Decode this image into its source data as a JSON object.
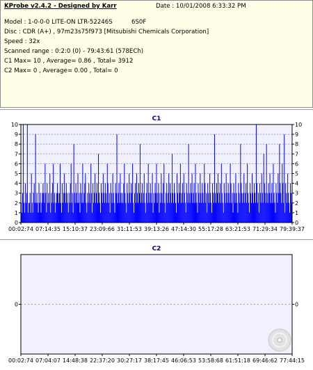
{
  "header": {
    "title": "KProbe v2.4.2 - Designed by Karr",
    "date": "Date : 10/01/2008 6:33:32 PM",
    "model": "Model : 1-0-0-0 LITE-ON LTR-52246S",
    "firmware": "6S0F",
    "disc": "Disc : CDR (A+) , 97m23s75f973 [Mitsubishi Chemicals Corporation]",
    "speed": "Speed : 32x",
    "scanned_range": "Scanned range : 0:2:0 (0) - 79:43:61 (578ECh)",
    "c1_stats": "C1 Max= 10 , Average= 0.86 , Total= 3912",
    "c2_stats": "C2 Max= 0 , Average= 0.00 , Total= 0"
  },
  "colors": {
    "info_background": "#ffffe7",
    "plot_background": "#f0f0ff",
    "c1_bars": "#0000ff",
    "title_blue": "#000080"
  },
  "chart_data": [
    {
      "type": "bar",
      "title": "C1",
      "ylim": [
        0,
        10
      ],
      "yticks": [
        "0",
        "1",
        "2",
        "3",
        "4",
        "5",
        "6",
        "7",
        "8",
        "9",
        "10"
      ],
      "xticks": [
        "00:02:74",
        "07:14:35",
        "15:10:37",
        "23:09:66",
        "31:11:53",
        "39:13:26",
        "47:14:30",
        "55:17:28",
        "63:21:53",
        "71:29:34",
        "79:39:37"
      ],
      "grid": true,
      "values": [
        2,
        1,
        3,
        10,
        2,
        1,
        4,
        2,
        3,
        10,
        1,
        2,
        2,
        3,
        1,
        5,
        2,
        1,
        3,
        4,
        2,
        9,
        2,
        3,
        2,
        1,
        4,
        2,
        3,
        1,
        2,
        3,
        4,
        3,
        2,
        6,
        3,
        1,
        4,
        2,
        3,
        2,
        5,
        1,
        3,
        2,
        4,
        6,
        2,
        3,
        1,
        2,
        3,
        4,
        3,
        2,
        3,
        6,
        2,
        1,
        4,
        2,
        3,
        5,
        3,
        2,
        4,
        3,
        2,
        1,
        3,
        2,
        4,
        6,
        2,
        3,
        1,
        8,
        3,
        2,
        4,
        3,
        2,
        5,
        2,
        3,
        1,
        4,
        3,
        2,
        6,
        2,
        3,
        4,
        5,
        2,
        1,
        3,
        2,
        4,
        3,
        2,
        6,
        3,
        1,
        4,
        2,
        3,
        5,
        2,
        3,
        4,
        2,
        7,
        3,
        2,
        1,
        4,
        3,
        2,
        5,
        3,
        2,
        4,
        3,
        2,
        6,
        4,
        2,
        3,
        1,
        4,
        3,
        2,
        5,
        3,
        2,
        1,
        4,
        3,
        9,
        2,
        3,
        4,
        2,
        5,
        3,
        2,
        3,
        2,
        4,
        6,
        3,
        2,
        1,
        4,
        3,
        2,
        5,
        3,
        2,
        4,
        3,
        6,
        2,
        1,
        3,
        4,
        2,
        5,
        3,
        2,
        4,
        3,
        8,
        2,
        3,
        4,
        2,
        3,
        5,
        2,
        1,
        3,
        4,
        2,
        6,
        3,
        2,
        4,
        3,
        2,
        5,
        1,
        3,
        2,
        4,
        3,
        6,
        2,
        3,
        4,
        1,
        3,
        2,
        5,
        3,
        2,
        4,
        6,
        2,
        1,
        3,
        4,
        2,
        3,
        5,
        2,
        4,
        3,
        2,
        7,
        3,
        2,
        4,
        3,
        2,
        1,
        5,
        3,
        2,
        4,
        3,
        6,
        2,
        3,
        4,
        2,
        5,
        3,
        2,
        1,
        4,
        3,
        2,
        8,
        3,
        2,
        4,
        3,
        5,
        2,
        3,
        4,
        2,
        6,
        3,
        2,
        1,
        4,
        3,
        2,
        5,
        3,
        2,
        4,
        3,
        2,
        6,
        4,
        2,
        3,
        1,
        4,
        3,
        2,
        5,
        3,
        2,
        1,
        4,
        3,
        2,
        9,
        3,
        2,
        4,
        3,
        5,
        2,
        3,
        4,
        2,
        6,
        3,
        2,
        1,
        4,
        3,
        2,
        5,
        3,
        2,
        4,
        3,
        2,
        6,
        4,
        2,
        3,
        1,
        4,
        3,
        2,
        5,
        3,
        2,
        1,
        4,
        3,
        2,
        8,
        4,
        3,
        2,
        3,
        5,
        2,
        3,
        4,
        2,
        6,
        3,
        2,
        1,
        4,
        3,
        2,
        5,
        3,
        2,
        4,
        3,
        2,
        10,
        4,
        2,
        3,
        1,
        4,
        3,
        2,
        5,
        3,
        2,
        7,
        4,
        3,
        2,
        8,
        3,
        2,
        4,
        3,
        5,
        2,
        3,
        4,
        2,
        6,
        3,
        2,
        1,
        4,
        3,
        2,
        5,
        3,
        8,
        4,
        3,
        2,
        6,
        4,
        2,
        9,
        1,
        4,
        3,
        2,
        5,
        3,
        2,
        1,
        4,
        3,
        2
      ]
    },
    {
      "type": "bar",
      "title": "C2",
      "ylim": [
        -1,
        1
      ],
      "yticks": [
        "0"
      ],
      "xticks": [
        "00:02:74",
        "07:04:07",
        "14:48:38",
        "22:37:20",
        "30:27:17",
        "38:17:45",
        "46:06:53",
        "53:58:68",
        "61:51:18",
        "69:46:62",
        "77:44:15"
      ],
      "grid": false,
      "values": []
    }
  ]
}
